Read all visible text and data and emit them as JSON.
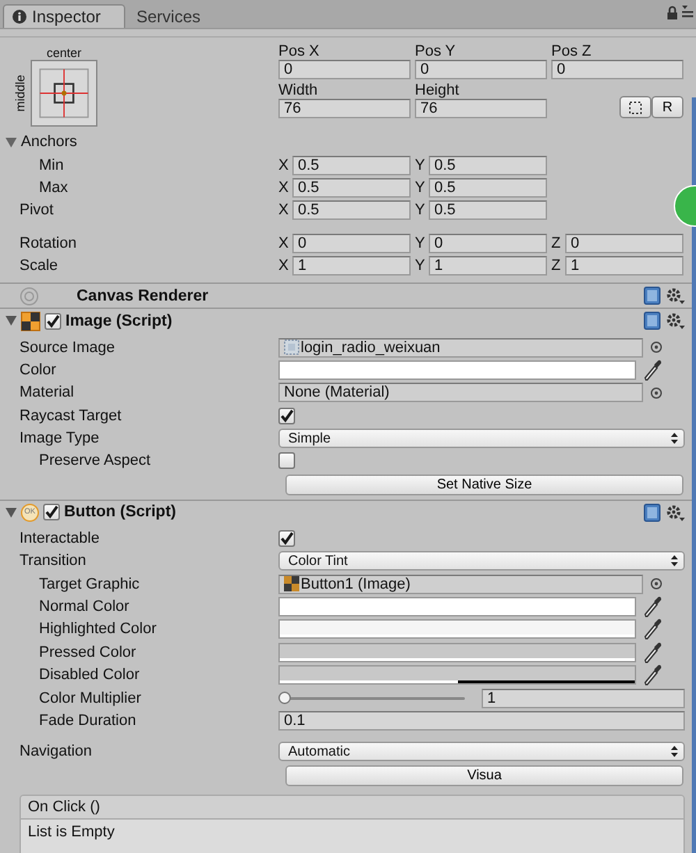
{
  "tabs": [
    {
      "label": "Inspector",
      "selected": true
    },
    {
      "label": "Services",
      "selected": false
    }
  ],
  "rect_transform": {
    "anchor_preset": {
      "horizontal": "center",
      "vertical": "middle"
    },
    "position": [
      {
        "label": "Pos X",
        "value": "0"
      },
      {
        "label": "Pos Y",
        "value": "0"
      },
      {
        "label": "Pos Z",
        "value": "0"
      }
    ],
    "size": [
      {
        "label": "Width",
        "value": "76"
      },
      {
        "label": "Height",
        "value": "76"
      }
    ],
    "reset_button": "R",
    "anchors": {
      "label": "Anchors",
      "expanded": true,
      "children": [
        {
          "label": "Min",
          "values": [
            {
              "axis": "X",
              "value": "0.5"
            },
            {
              "axis": "Y",
              "value": "0.5"
            }
          ]
        },
        {
          "label": "Max",
          "values": [
            {
              "axis": "X",
              "value": "0.5"
            },
            {
              "axis": "Y",
              "value": "0.5"
            }
          ]
        }
      ]
    },
    "pivot": {
      "label": "Pivot",
      "values": [
        {
          "axis": "X",
          "value": "0.5"
        },
        {
          "axis": "Y",
          "value": "0.5"
        }
      ]
    },
    "transform_rows": [
      {
        "label": "Rotation",
        "values": [
          {
            "axis": "X",
            "value": "0"
          },
          {
            "axis": "Y",
            "value": "0"
          },
          {
            "axis": "Z",
            "value": "0"
          }
        ]
      },
      {
        "label": "Scale",
        "values": [
          {
            "axis": "X",
            "value": "1"
          },
          {
            "axis": "Y",
            "value": "1"
          },
          {
            "axis": "Z",
            "value": "1"
          }
        ]
      }
    ]
  },
  "components": [
    {
      "kind": "renderer",
      "title": "Canvas Renderer"
    },
    {
      "kind": "script",
      "title": "Image (Script)",
      "enabled": true,
      "expanded": true,
      "properties": [
        {
          "kind": "sprite_ref",
          "label": "Source Image",
          "value": "login_radio_weixuan"
        },
        {
          "kind": "color",
          "label": "Color",
          "color": "#ffffff",
          "level": 1
        },
        {
          "kind": "object",
          "label": "Material",
          "value": "None (Material)"
        },
        {
          "kind": "checkbox",
          "label": "Raycast Target",
          "checked": true
        },
        {
          "kind": "dropdown",
          "label": "Image Type",
          "value": "Simple",
          "children": [
            {
              "kind": "checkbox",
              "label": "Preserve Aspect",
              "checked": false
            }
          ]
        },
        {
          "kind": "button",
          "label": "Set Native Size"
        }
      ]
    },
    {
      "kind": "script",
      "title": "Button (Script)",
      "badge": "OK",
      "enabled": true,
      "expanded": true,
      "properties": [
        {
          "kind": "checkbox",
          "label": "Interactable",
          "checked": true
        },
        {
          "kind": "dropdown",
          "label": "Transition",
          "value": "Color Tint",
          "children": [
            {
              "kind": "image_ref",
              "label": "Target Graphic",
              "value": "Button1 (Image)"
            },
            {
              "kind": "color",
              "label": "Normal Color",
              "color": "#ffffff",
              "level": 1
            },
            {
              "kind": "color",
              "label": "Highlighted Color",
              "color": "#f5f5f5",
              "level": 1
            },
            {
              "kind": "color",
              "label": "Pressed Color",
              "color": "#c8c8c8",
              "level": 1
            },
            {
              "kind": "color",
              "label": "Disabled Color",
              "color": "#c8c8c8",
              "level": 0.5
            },
            {
              "kind": "slider",
              "label": "Color Multiplier",
              "level": 0,
              "value": "1"
            },
            {
              "kind": "number",
              "label": "Fade Duration",
              "value": "0.1"
            }
          ]
        },
        {
          "kind": "dropdown",
          "label": "Navigation",
          "value": "Automatic"
        },
        {
          "kind": "button",
          "label": "Visua"
        }
      ]
    }
  ],
  "event": {
    "title": "On Click ()",
    "body": "List is Empty"
  }
}
